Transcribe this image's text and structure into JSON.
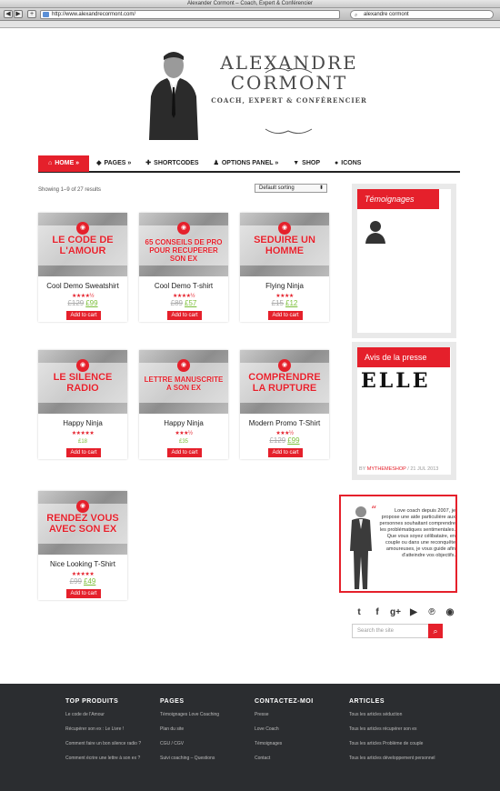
{
  "browser": {
    "window_title": "Alexander Cormont – Coach, Expert & Conférencier",
    "url": "http://www.alexandrecormont.com/",
    "search_query": "alexandre cormont",
    "back": "◀",
    "forward": "▶",
    "add": "+"
  },
  "brand": {
    "line1": "ALEXANDRE",
    "line2": "CORMONT",
    "tagline": "COACH, EXPERT & CONFÉRENCIER"
  },
  "nav": [
    {
      "icon": "⌂",
      "label": "HOME »"
    },
    {
      "icon": "◆",
      "label": "PAGES »"
    },
    {
      "icon": "✚",
      "label": "SHORTCODES"
    },
    {
      "icon": "♟",
      "label": "OPTIONS PANEL »"
    },
    {
      "icon": "▼",
      "label": "SHOP"
    },
    {
      "icon": "●",
      "label": "ICONS"
    }
  ],
  "shop": {
    "showing": "Showing 1–9 of 27 results",
    "sorting": "Default sorting",
    "sorting_arrow": "⬍",
    "add_to_cart": "Add to cart"
  },
  "products": [
    {
      "overlay": "LE CODE DE L'AMOUR",
      "name": "Cool Demo Sweatshirt",
      "stars": "★★★★½",
      "old_price": "£129",
      "new_price": "£99",
      "ribbon": "◉"
    },
    {
      "overlay": "65 CONSEILS DE PRO POUR RECUPERER SON EX",
      "name": "Cool Demo T-shirt",
      "stars": "★★★★½",
      "old_price": "£89",
      "new_price": "£57",
      "ribbon": "◉"
    },
    {
      "overlay": "SEDUIRE UN HOMME",
      "name": "Flying Ninja",
      "stars": "★★★★",
      "old_price": "£15",
      "new_price": "£12",
      "ribbon": "◉"
    },
    {
      "overlay": "LE SILENCE RADIO",
      "name": "Happy Ninja",
      "stars": "★★★★★",
      "price": "£18",
      "ribbon": "◉"
    },
    {
      "overlay": "LETTRE MANUSCRITE A SON EX",
      "name": "Happy Ninja",
      "stars": "★★★½",
      "price": "£35",
      "ribbon": "◉"
    },
    {
      "overlay": "COMPRENDRE LA RUPTURE",
      "name": "Modern Promo T-Shirt",
      "stars": "★★★½",
      "old_price": "£129",
      "new_price": "£99",
      "ribbon": "◉"
    },
    {
      "overlay": "RENDEZ VOUS AVEC SON EX",
      "name": "Nice Looking T-Shirt",
      "stars": "★★★★★",
      "old_price": "£99",
      "new_price": "£49",
      "ribbon": "◉"
    }
  ],
  "sidebar": {
    "testimonials_title": "Témoignages",
    "press_title": "Avis de la presse",
    "press_logo": "ELLE",
    "byline_by": "BY ",
    "byline_author": "MYTHEMESHOP",
    "byline_date": " / 21 JUL 2013",
    "promo_quote": "“",
    "promo_text": "Love coach depuis 2007, je propose une aide particulière aux personnes souhaitant comprendre les problématiques sentimentales. Que vous soyez célibataire, en couple ou dans une reconquête amoureuses, je vous guide afin d'atteindre vos objectifs.",
    "socials": [
      "t",
      "f",
      "g+",
      "▶",
      "℗",
      "◉"
    ],
    "search_placeholder": "Search the site",
    "search_btn": "⌕"
  },
  "footer": [
    {
      "heading": "TOP PRODUITS",
      "links": [
        "Le code de l'Amour",
        "Récupérer son ex : Le Livre !",
        "Comment faire un bon silence radio ?",
        "Comment écrire une lettre à son ex ?"
      ]
    },
    {
      "heading": "PAGES",
      "links": [
        "Témoignages Love Coaching",
        "Plan du site",
        "CGU / CGV",
        "Suivi coaching – Questions"
      ]
    },
    {
      "heading": "CONTACTEZ-MOI",
      "links": [
        "Presse",
        "Love Coach",
        "Témoignages",
        "Contact"
      ]
    },
    {
      "heading": "ARTICLES",
      "links": [
        "Tous les articles séduction",
        "Tous les articles récupérer son ex",
        "Tous les articles Problème de couple",
        "Tous les articles développement personnel"
      ]
    }
  ],
  "colors": {
    "accent": "#e5202b",
    "footer_bg": "#2b2d30",
    "price_green": "#7cbf3a"
  }
}
